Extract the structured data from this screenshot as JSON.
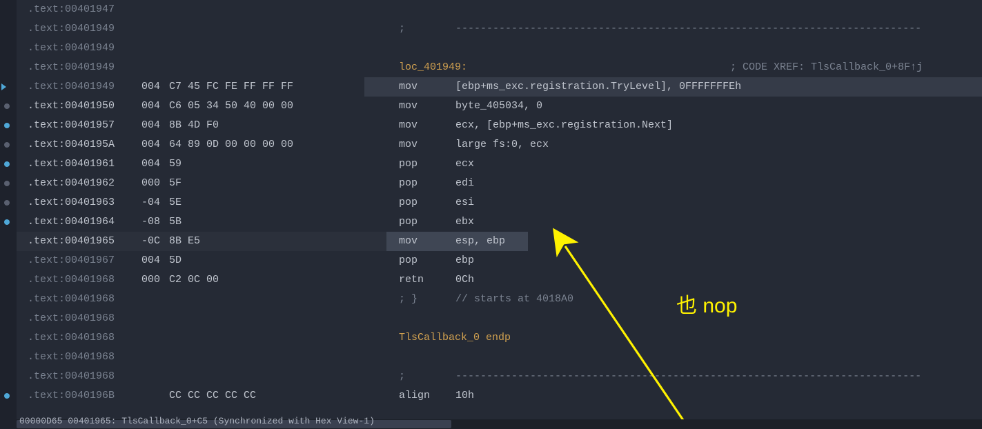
{
  "rows": [
    {
      "marker": null,
      "dim": true,
      "addr": ".text:00401947",
      "sp": "",
      "bytes": "",
      "mcol": "",
      "ocol": "",
      "comment": ""
    },
    {
      "marker": null,
      "dim": true,
      "addr": ".text:00401949",
      "sp": "",
      "bytes": "",
      "mcol": ";",
      "ocol": "---------------------------------------------------------------------------",
      "comment": ""
    },
    {
      "marker": null,
      "dim": true,
      "addr": ".text:00401949",
      "sp": "",
      "bytes": "",
      "mcol": "",
      "ocol": "",
      "comment": ""
    },
    {
      "marker": null,
      "dim": true,
      "addr": ".text:00401949",
      "sp": "",
      "bytes": "",
      "mcol": "",
      "ocol": "",
      "label": "loc_401949:",
      "xref": "; CODE XREF: TlsCallback_0+8F↑j"
    },
    {
      "marker": "arrow",
      "dim": true,
      "sel": true,
      "addr": ".text:00401949",
      "sp": "004",
      "bytes": "C7 45 FC FE FF FF FF",
      "mcol": "mov",
      "ocol": "[ebp+ms_exc.registration.TryLevel], 0FFFFFFFEh",
      "comment": ""
    },
    {
      "marker": "gray",
      "dim": false,
      "addr": ".text:00401950",
      "sp": "004",
      "bytes": "C6 05 34 50 40 00 00",
      "mcol": "mov",
      "ocol": "byte_405034, 0",
      "comment": ""
    },
    {
      "marker": "blue",
      "dim": false,
      "addr": ".text:00401957",
      "sp": "004",
      "bytes": "8B 4D F0",
      "mcol": "mov",
      "ocol": "ecx, [ebp+ms_exc.registration.Next]",
      "comment": ""
    },
    {
      "marker": "gray",
      "dim": false,
      "addr": ".text:0040195A",
      "sp": "004",
      "bytes": "64 89 0D 00 00 00 00",
      "mcol": "mov",
      "ocol": "large fs:0, ecx",
      "comment": ""
    },
    {
      "marker": "blue",
      "dim": false,
      "addr": ".text:00401961",
      "sp": "004",
      "bytes": "59",
      "mcol": "pop",
      "ocol": "ecx",
      "comment": ""
    },
    {
      "marker": "gray",
      "dim": false,
      "addr": ".text:00401962",
      "sp": "000",
      "bytes": "5F",
      "mcol": "pop",
      "ocol": "edi",
      "comment": ""
    },
    {
      "marker": "gray",
      "dim": false,
      "addr": ".text:00401963",
      "sp": "-04",
      "bytes": "5E",
      "mcol": "pop",
      "ocol": "esi",
      "comment": ""
    },
    {
      "marker": "blue",
      "dim": false,
      "addr": ".text:00401964",
      "sp": "-08",
      "bytes": "5B",
      "mcol": "pop",
      "ocol": "ebx",
      "comment": ""
    },
    {
      "marker": null,
      "dim": false,
      "hl": true,
      "addr": ".text:00401965",
      "sp": "-0C",
      "bytes": "8B E5",
      "mcol": "mov",
      "ocol": "esp, ebp",
      "comment": ""
    },
    {
      "marker": null,
      "dim": true,
      "addr": ".text:00401967",
      "sp": "004",
      "bytes": "5D",
      "mcol": "pop",
      "ocol": "ebp",
      "comment": ""
    },
    {
      "marker": null,
      "dim": true,
      "addr": ".text:00401968",
      "sp": "000",
      "bytes": "C2 0C 00",
      "mcol": "retn",
      "ocol": "0Ch",
      "comment": ""
    },
    {
      "marker": null,
      "dim": true,
      "addr": ".text:00401968",
      "sp": "",
      "bytes": "",
      "mcol": "; }",
      "ocol": "// starts at 4018A0",
      "isComment": true
    },
    {
      "marker": null,
      "dim": true,
      "addr": ".text:00401968",
      "sp": "",
      "bytes": "",
      "mcol": "",
      "ocol": "",
      "comment": ""
    },
    {
      "marker": null,
      "dim": true,
      "addr": ".text:00401968",
      "sp": "",
      "bytes": "",
      "mcol": "",
      "ocol": "",
      "label": "TlsCallback_0 endp",
      "labelClass": "label"
    },
    {
      "marker": null,
      "dim": true,
      "addr": ".text:00401968",
      "sp": "",
      "bytes": "",
      "mcol": "",
      "ocol": "",
      "comment": ""
    },
    {
      "marker": null,
      "dim": true,
      "addr": ".text:00401968",
      "sp": "",
      "bytes": "",
      "mcol": ";",
      "ocol": "---------------------------------------------------------------------------",
      "comment": ""
    },
    {
      "marker": "blue",
      "dim": true,
      "addr": ".text:0040196B",
      "sp": "",
      "bytes": "CC CC CC CC CC",
      "mcol": "align",
      "ocol": "10h",
      "comment": ""
    }
  ],
  "status": "00000D65 00401965: TlsCallback_0+C5 (Synchronized with Hex View-1)",
  "annotation": "也 nop",
  "columns": {
    "addrStart": 40,
    "spStart": 205,
    "bytesStart": 245,
    "mcolStart": 578,
    "ocolStart": 660,
    "xrefStart": 1058
  }
}
